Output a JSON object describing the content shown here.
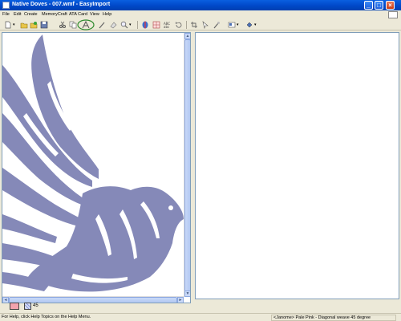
{
  "window": {
    "title": "Native Doves - 007.wmf - EasyImport",
    "minimize": "_",
    "maximize": "□",
    "close": "×"
  },
  "menu": {
    "items": [
      {
        "label": "File",
        "name": "menu-file"
      },
      {
        "label": "Edit",
        "name": "menu-edit"
      },
      {
        "label": "Create",
        "name": "menu-create"
      },
      {
        "label": "MemoryCraft",
        "name": "menu-memorycraft"
      },
      {
        "label": "ATA Card",
        "name": "menu-ata-card"
      },
      {
        "label": "View",
        "name": "menu-view"
      },
      {
        "label": "Help",
        "name": "menu-help"
      }
    ]
  },
  "toolbar": {
    "tools": [
      "new",
      "open",
      "open-folder",
      "save",
      "cut",
      "copy",
      "auto-digitize",
      "pen",
      "eraser",
      "zoom",
      "color-wheel",
      "palette",
      "abc-text",
      "rotate",
      "crop",
      "pointer",
      "magic-wand",
      "image",
      "fill"
    ]
  },
  "scroll": {
    "up": "▲",
    "down": "▼",
    "left": "◄",
    "right": "►"
  },
  "bottom": {
    "weave_angle": "45",
    "fill_color": "#F2A3AE"
  },
  "status": {
    "left": "For Help, click Help Topics on the Help Menu.",
    "right": "<Janome> Pale Pink - Diagonal weave 45 degree"
  },
  "colors": {
    "dove": "#8589B8",
    "titlebar": "#0048C8",
    "highlight": "#2E8B2E"
  }
}
